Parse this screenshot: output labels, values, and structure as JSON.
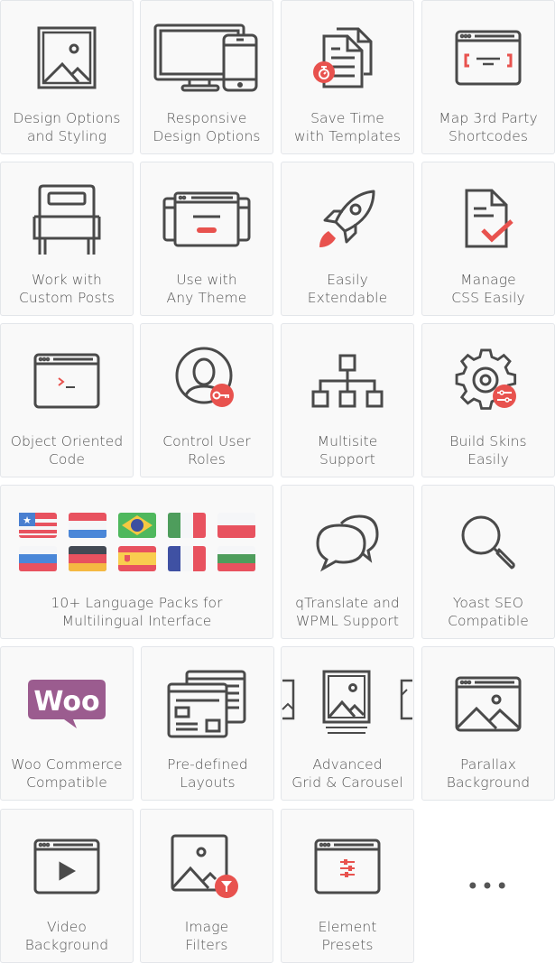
{
  "colors": {
    "icon": "#4a4a4a",
    "accent": "#e8524e",
    "woo": "#9b5c8f",
    "tile_bg": "#f9f9f9",
    "tile_border": "#e3e6ea",
    "text": "#555555"
  },
  "features": [
    {
      "icon": "image-frame-icon",
      "line1": "Design Options",
      "line2": "and Styling"
    },
    {
      "icon": "monitor-phone-icon",
      "line1": "Responsive",
      "line2": "Design Options"
    },
    {
      "icon": "templates-timer-icon",
      "line1": "Save Time",
      "line2": "with Templates"
    },
    {
      "icon": "shortcode-window-icon",
      "line1": "Map 3rd Party",
      "line2": "Shortcodes"
    },
    {
      "icon": "custom-posts-icon",
      "line1": "Work with",
      "line2": "Custom Posts"
    },
    {
      "icon": "theme-windows-icon",
      "line1": "Use with",
      "line2": "Any Theme"
    },
    {
      "icon": "rocket-icon",
      "line1": "Easily",
      "line2": "Extendable"
    },
    {
      "icon": "css-check-document-icon",
      "line1": "Manage",
      "line2": "CSS Easily"
    },
    {
      "icon": "terminal-window-icon",
      "line1": "Object Oriented",
      "line2": "Code"
    },
    {
      "icon": "user-key-icon",
      "line1": "Control User",
      "line2": "Roles"
    },
    {
      "icon": "sitemap-icon",
      "line1": "Multisite",
      "line2": "Support"
    },
    {
      "icon": "gear-sliders-icon",
      "line1": "Build Skins",
      "line2": "Easily"
    },
    {
      "icon": "flags-icon",
      "line1": "10+ Language Packs for",
      "line2": "Multilingual Interface"
    },
    {
      "icon": "speech-bubbles-icon",
      "line1": "qTranslate and",
      "line2": "WPML Support"
    },
    {
      "icon": "magnifier-icon",
      "line1": "Yoast SEO",
      "line2": "Compatible"
    },
    {
      "icon": "woo-logo-icon",
      "woo_text": "Woo",
      "line1": "Woo Commerce",
      "line2": "Compatible"
    },
    {
      "icon": "layouts-icon",
      "line1": "Pre-defined",
      "line2": "Layouts"
    },
    {
      "icon": "carousel-icon",
      "line1": "Advanced",
      "line2": "Grid & Carousel"
    },
    {
      "icon": "parallax-window-icon",
      "line1": "Parallax",
      "line2": "Background"
    },
    {
      "icon": "video-window-icon",
      "line1": "Video",
      "line2": "Background"
    },
    {
      "icon": "image-filter-icon",
      "line1": "Image",
      "line2": "Filters"
    },
    {
      "icon": "presets-window-icon",
      "line1": "Element",
      "line2": "Presets"
    }
  ],
  "more": "•••"
}
